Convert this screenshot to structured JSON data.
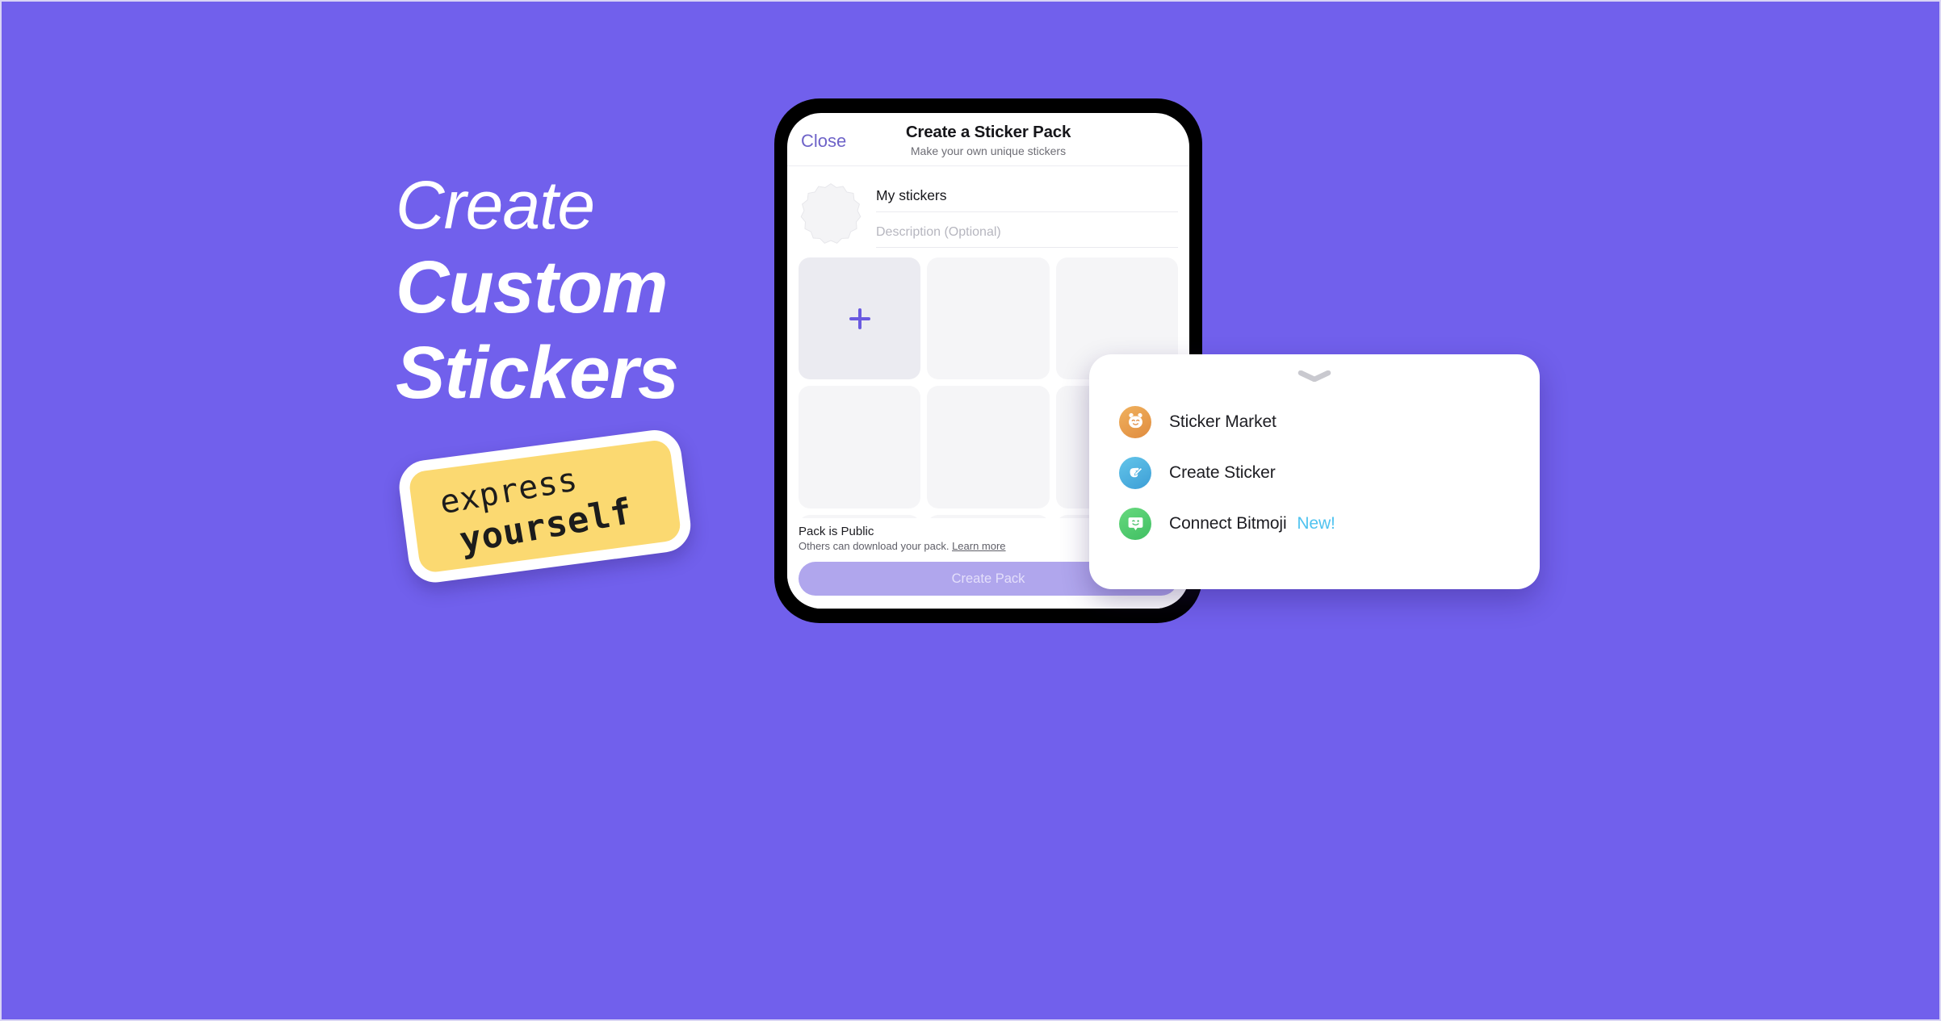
{
  "background_color": "#7160ec",
  "promo": {
    "headline_line1": "Create",
    "headline_line2": "Custom",
    "headline_line3": "Stickers",
    "sticker_badge": {
      "line1": "express",
      "line2": "yourself",
      "background_color": "#fbd971",
      "border_color": "#ffffff"
    }
  },
  "phone": {
    "header": {
      "close_label": "Close",
      "title": "Create a Sticker Pack",
      "subtitle": "Make your own unique stickers",
      "close_color": "#6e63c8"
    },
    "pack": {
      "avatar_icon": "scalloped-badge-placeholder",
      "name_value": "My stickers",
      "description_placeholder": "Description (Optional)"
    },
    "grid": {
      "add_icon": "plus-icon",
      "columns": 3,
      "cells": [
        {
          "type": "add"
        },
        {
          "type": "empty"
        },
        {
          "type": "empty"
        },
        {
          "type": "empty"
        },
        {
          "type": "empty"
        },
        {
          "type": "empty"
        },
        {
          "type": "empty"
        },
        {
          "type": "empty"
        },
        {
          "type": "empty"
        },
        {
          "type": "empty"
        },
        {
          "type": "empty"
        },
        {
          "type": "empty"
        },
        {
          "type": "empty"
        },
        {
          "type": "empty"
        },
        {
          "type": "empty"
        }
      ]
    },
    "public_setting": {
      "label": "Pack is Public",
      "sub_text": "Others can download your pack.",
      "link_text": "Learn more",
      "toggle_on": true,
      "toggle_color": "#6355d8"
    },
    "primary_button": {
      "label": "Create Pack",
      "background_color": "#b0a6ed",
      "disabled": true
    }
  },
  "menu": {
    "handle_icon": "chevron-down-icon",
    "items": [
      {
        "label": "Sticker Market",
        "icon": "bear-face-icon",
        "icon_color": "#e59a4a",
        "badge": ""
      },
      {
        "label": "Create Sticker",
        "icon": "hand-pen-icon",
        "icon_color": "#4aaede",
        "badge": ""
      },
      {
        "label": "Connect Bitmoji",
        "icon": "bitmoji-bubble-icon",
        "icon_color": "#4fc86f",
        "badge": "New!",
        "badge_color": "#4fc3f0"
      }
    ]
  }
}
